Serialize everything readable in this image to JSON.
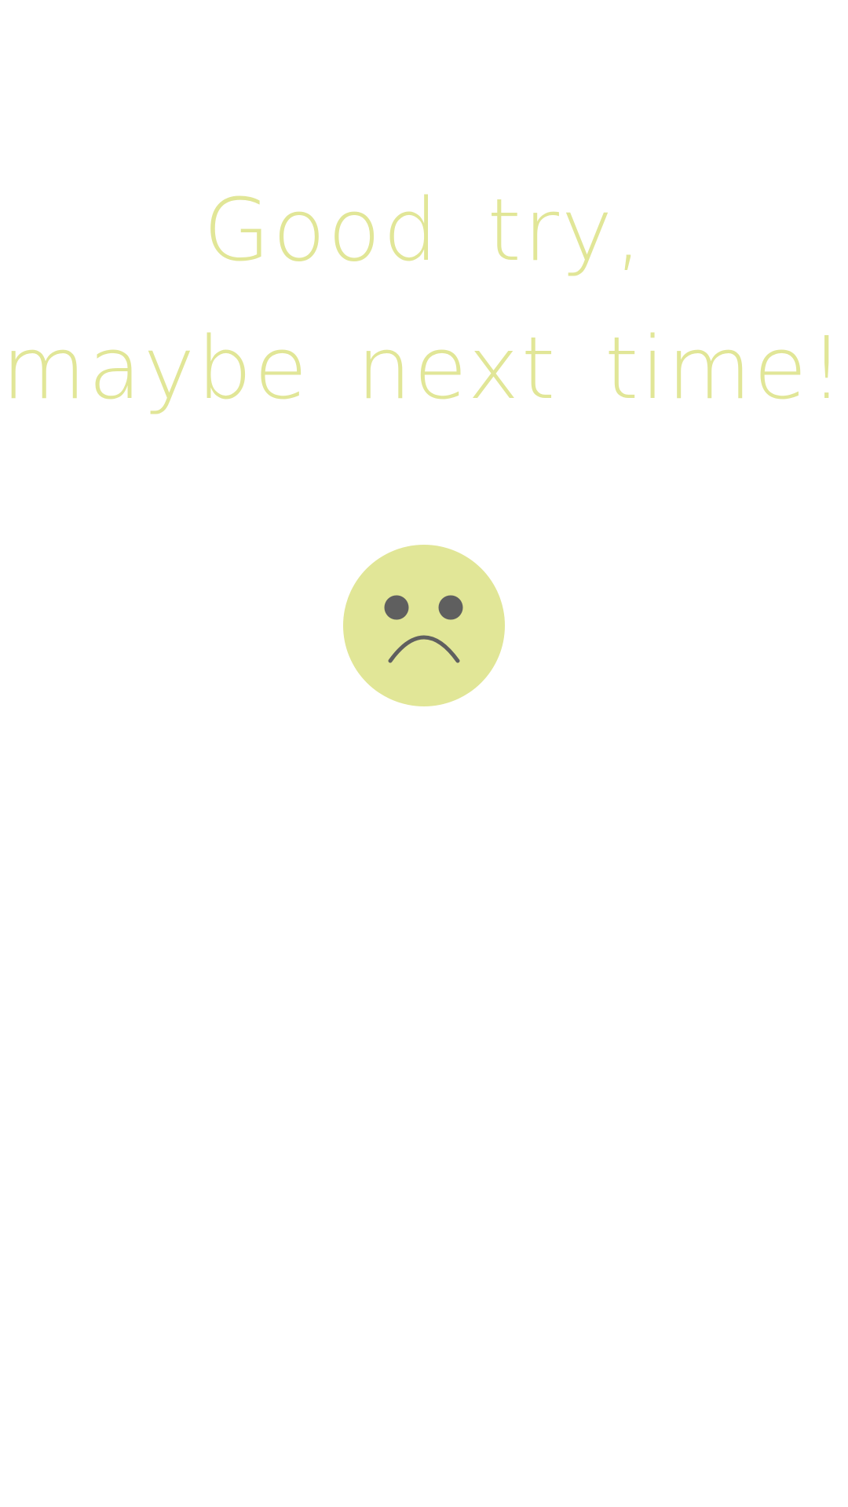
{
  "message": {
    "line1": "Good try,",
    "line2": "maybe next time!"
  },
  "icons": {
    "face": "sad-face-icon"
  },
  "colors": {
    "background": "#ffffff",
    "accent": "#e1e697",
    "face_features": "#5f5f5f"
  }
}
